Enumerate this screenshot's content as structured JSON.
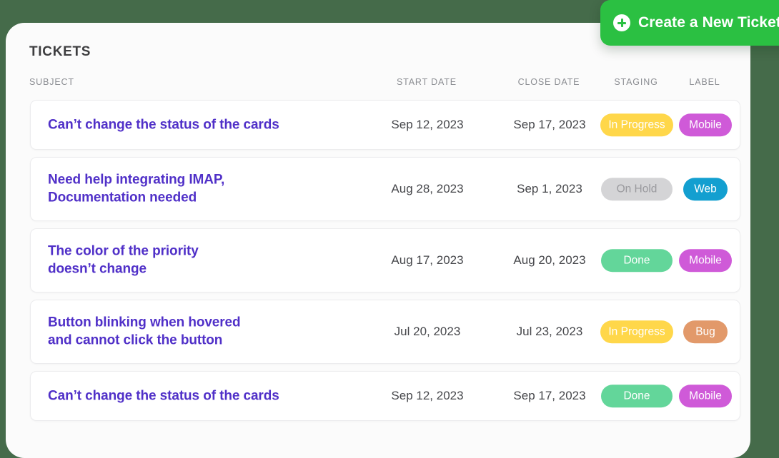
{
  "theme": {
    "page_background": "#456b4a",
    "panel_background": "#fbfbfb",
    "row_background": "#ffffff",
    "subject_color": "#5030c8",
    "cta_color": "#2bc042"
  },
  "cta": {
    "label": "Create a New Ticket",
    "icon": "plus-circle-icon"
  },
  "panel": {
    "title": "TICKETS"
  },
  "columns": [
    {
      "key": "subject",
      "label": "SUBJECT"
    },
    {
      "key": "start_date",
      "label": "START DATE"
    },
    {
      "key": "close_date",
      "label": "CLOSE DATE"
    },
    {
      "key": "staging",
      "label": "STAGING"
    },
    {
      "key": "label",
      "label": "LABEL"
    }
  ],
  "rows": [
    {
      "subject": "Can’t change the status of the cards",
      "start_date": "Sep 12, 2023",
      "close_date": "Sep 17, 2023",
      "staging": {
        "text": "In Progress",
        "bg": "#ffd74a",
        "fg": "#ffffff"
      },
      "label": {
        "text": "Mobile",
        "bg": "#cf5ad8",
        "fg": "#ffffff"
      }
    },
    {
      "subject": "Need help integrating IMAP,\nDocumentation needed",
      "start_date": "Aug 28, 2023",
      "close_date": "Sep 1, 2023",
      "staging": {
        "text": "On Hold",
        "bg": "#d4d4d6",
        "fg": "#9a9a9e"
      },
      "label": {
        "text": "Web",
        "bg": "#139fd0",
        "fg": "#ffffff"
      }
    },
    {
      "subject": "The color of the priority\ndoesn’t change",
      "start_date": "Aug 17, 2023",
      "close_date": "Aug 20, 2023",
      "staging": {
        "text": "Done",
        "bg": "#63d69a",
        "fg": "#ffffff"
      },
      "label": {
        "text": "Mobile",
        "bg": "#cf5ad8",
        "fg": "#ffffff"
      }
    },
    {
      "subject": "Button blinking when hovered\nand cannot click the button",
      "start_date": "Jul 20, 2023",
      "close_date": "Jul 23, 2023",
      "staging": {
        "text": "In Progress",
        "bg": "#ffd74a",
        "fg": "#ffffff"
      },
      "label": {
        "text": "Bug",
        "bg": "#e2996a",
        "fg": "#ffffff"
      }
    },
    {
      "subject": "Can’t change the status of the cards",
      "start_date": "Sep 12, 2023",
      "close_date": "Sep 17, 2023",
      "staging": {
        "text": "Done",
        "bg": "#63d69a",
        "fg": "#ffffff"
      },
      "label": {
        "text": "Mobile",
        "bg": "#cf5ad8",
        "fg": "#ffffff"
      }
    }
  ]
}
